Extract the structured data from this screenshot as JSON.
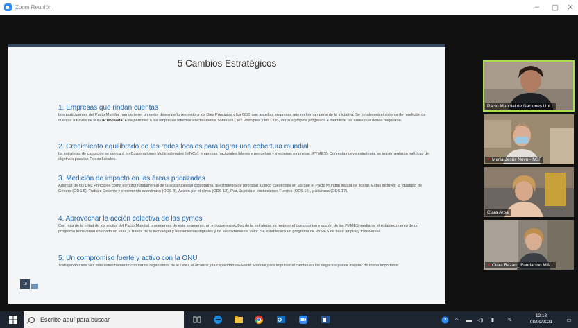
{
  "window": {
    "title": "Zoom Reunión"
  },
  "slide": {
    "heading": "5 Cambios Estratégicos",
    "page_number": "10",
    "sections": [
      {
        "title": "1.  Empresas que rindan cuentas",
        "body_before": "Los participantes del Pacto Mundial han de tener un mejor desempeño respecto a los Diez Principios y los ODS que aquellas empresas que no forman parte de la iniciativa. Se fortalecerá el sistema de rendición de cuentas a través de la ",
        "body_bold": "COP revisada",
        "body_after": ". Esta permitirá a las empresas informar efectivamente sobre los Diez Principios y los ODS, ver sus propios progresos e identificar las áreas que deben mejorarse."
      },
      {
        "title": "2.  Crecimiento equilibrado de las redes locales para lograr una cobertura mundial",
        "body": "La estrategia de captación se centrará en Corporaciones Multinacionales (MNCs), empresas nacionales líderes y pequeñas y medianas empresas (PYMES). Con esta nueva estrategia, se implementarán métricas de objetivos para las Redes Locales."
      },
      {
        "title": "3.  Medición de impacto en las áreas priorizadas",
        "body": "Además de los Diez Principios como el motor fundamental de la sostenibilidad corporativa, la estrategia de prioridad a cinco cuestiones en las que el Pacto Mundial tratará de liderar. Estas incluyen la Igualdad de Género (ODS 5), Trabajo Decente y crecimiento económico (ODS 8), Acción por el clima (ODS 13), Paz, Justicia e Instituciones Fuertes (ODS 16), y Alianzas (ODS 17)."
      },
      {
        "title": "4.  Aprovechar la acción colectiva de las pymes",
        "body": "Con más de la mitad de los socios del Pacto Mundial procedentes de este segmento, un enfoque específico de la estrategia es mejorar el compromiso y acción de las PYMES mediante el establecimiento de un programa transversal enfocado en ellas, a través de la tecnología y herramientas digitales y de las cadenas de valor. Se establecerá un programa de PYMES de base amplia y transversal."
      },
      {
        "title": "5.  Un compromiso fuerte y activo con la ONU",
        "body": "Trabajando cada vez más estrechamente con varios organismos de la ONU, el alcance y la capacidad del Pacto Mundial para impulsar el cambio en los negocios puede mejorar de forma importante."
      }
    ]
  },
  "participants": [
    {
      "name": "Pacto Mundial de Naciones Uni...",
      "muted": false,
      "active": true
    },
    {
      "name": "María Jesús Novo - NSF",
      "muted": true,
      "active": false
    },
    {
      "name": "Clara Arpa",
      "muted": false,
      "active": false
    },
    {
      "name": "Clara Bazan_ Fundacion MA...",
      "muted": true,
      "active": false
    }
  ],
  "taskbar": {
    "search_placeholder": "Escribe aquí para buscar",
    "time": "12:13",
    "date": "08/09/2021",
    "icons": [
      "task-view-icon",
      "edge-icon",
      "file-explorer-icon",
      "chrome-icon",
      "outlook-icon",
      "zoom-icon",
      "word-icon"
    ]
  },
  "colors": {
    "section_title": "#1f67ad",
    "slide_bar": "#34475f",
    "active_speaker": "#a6e04a",
    "taskbar": "#1c2530"
  }
}
